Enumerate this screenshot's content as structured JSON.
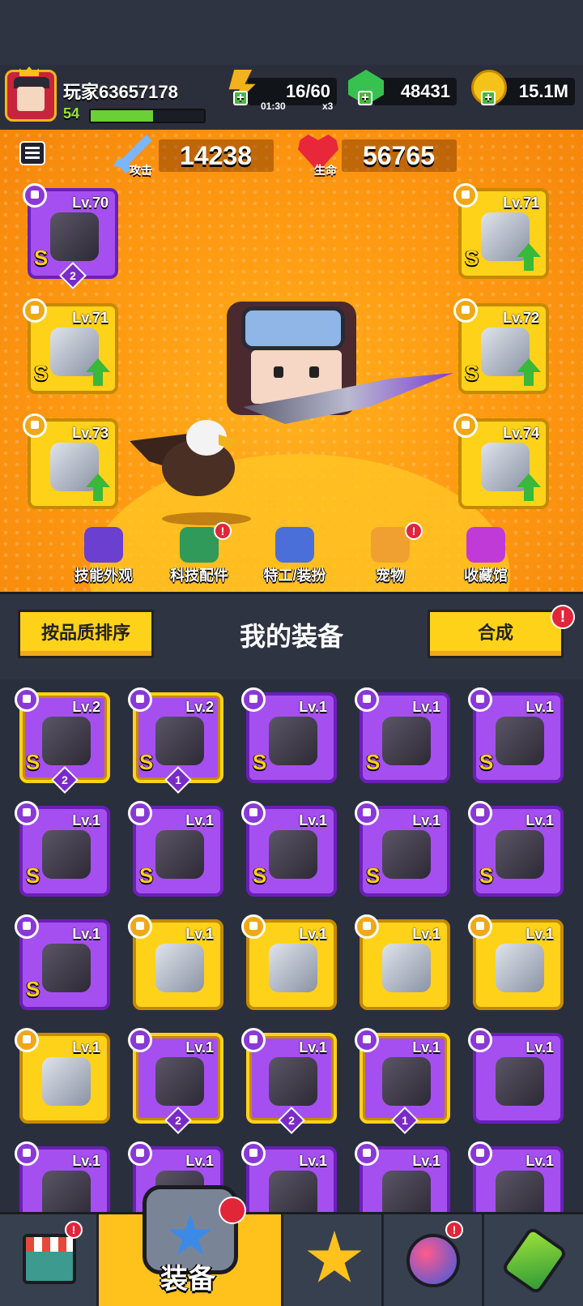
{
  "player": {
    "name": "玩家63657178",
    "level": "54",
    "xp_fraction": 0.55
  },
  "resources": {
    "energy": {
      "value": "16/60",
      "timer": "01:30",
      "multiplier": "x3",
      "icon": "energy-icon"
    },
    "gems": {
      "value": "48431",
      "icon": "gem-icon"
    },
    "coins": {
      "value": "15.1M",
      "icon": "coin-icon"
    }
  },
  "stats": {
    "attack": {
      "label": "攻击",
      "value": "14238"
    },
    "health": {
      "label": "生命",
      "value": "56765"
    }
  },
  "equipped": {
    "left": [
      {
        "level": "Lv.70",
        "grade": "S",
        "stars": "2",
        "color": "purple",
        "upgrade": false
      },
      {
        "level": "Lv.71",
        "grade": "S",
        "stars": "",
        "color": "gold",
        "upgrade": true
      },
      {
        "level": "Lv.73",
        "grade": "",
        "stars": "",
        "color": "gold",
        "upgrade": true
      }
    ],
    "right": [
      {
        "level": "Lv.71",
        "grade": "S",
        "stars": "",
        "color": "gold",
        "upgrade": true
      },
      {
        "level": "Lv.72",
        "grade": "S",
        "stars": "",
        "color": "gold",
        "upgrade": true
      },
      {
        "level": "Lv.74",
        "grade": "",
        "stars": "",
        "color": "gold",
        "upgrade": true
      }
    ]
  },
  "feature_bar": [
    {
      "label": "技能外观",
      "icon": "skill-skin-icon",
      "badge": false
    },
    {
      "label": "科技配件",
      "icon": "tech-parts-icon",
      "badge": true
    },
    {
      "label": "特工/装扮",
      "icon": "agent-costume-icon",
      "badge": false
    },
    {
      "label": "宠物",
      "icon": "pet-icon",
      "badge": true
    },
    {
      "label": "收藏馆",
      "icon": "collection-icon",
      "badge": false
    }
  ],
  "equipment_bar": {
    "sort_label": "按品质排序",
    "title": "我的装备",
    "merge_label": "合成"
  },
  "inventory": [
    {
      "level": "Lv.2",
      "grade": "S",
      "stars": "2",
      "color": "purple",
      "gold_frame": true
    },
    {
      "level": "Lv.2",
      "grade": "S",
      "stars": "1",
      "color": "purple",
      "gold_frame": true
    },
    {
      "level": "Lv.1",
      "grade": "S",
      "stars": "",
      "color": "purple",
      "gold_frame": false
    },
    {
      "level": "Lv.1",
      "grade": "S",
      "stars": "",
      "color": "purple",
      "gold_frame": false
    },
    {
      "level": "Lv.1",
      "grade": "S",
      "stars": "",
      "color": "purple",
      "gold_frame": false
    },
    {
      "level": "Lv.1",
      "grade": "S",
      "stars": "",
      "color": "purple",
      "gold_frame": false
    },
    {
      "level": "Lv.1",
      "grade": "S",
      "stars": "",
      "color": "purple",
      "gold_frame": false
    },
    {
      "level": "Lv.1",
      "grade": "S",
      "stars": "",
      "color": "purple",
      "gold_frame": false
    },
    {
      "level": "Lv.1",
      "grade": "S",
      "stars": "",
      "color": "purple",
      "gold_frame": false
    },
    {
      "level": "Lv.1",
      "grade": "S",
      "stars": "",
      "color": "purple",
      "gold_frame": false
    },
    {
      "level": "Lv.1",
      "grade": "S",
      "stars": "",
      "color": "purple",
      "gold_frame": false
    },
    {
      "level": "Lv.1",
      "grade": "",
      "stars": "",
      "color": "gold",
      "gold_frame": false
    },
    {
      "level": "Lv.1",
      "grade": "",
      "stars": "",
      "color": "gold",
      "gold_frame": false
    },
    {
      "level": "Lv.1",
      "grade": "",
      "stars": "",
      "color": "gold",
      "gold_frame": false
    },
    {
      "level": "Lv.1",
      "grade": "",
      "stars": "",
      "color": "gold",
      "gold_frame": false
    },
    {
      "level": "Lv.1",
      "grade": "",
      "stars": "",
      "color": "gold",
      "gold_frame": false
    },
    {
      "level": "Lv.1",
      "grade": "",
      "stars": "2",
      "color": "purple",
      "gold_frame": true
    },
    {
      "level": "Lv.1",
      "grade": "",
      "stars": "2",
      "color": "purple",
      "gold_frame": true
    },
    {
      "level": "Lv.1",
      "grade": "",
      "stars": "1",
      "color": "purple",
      "gold_frame": true
    },
    {
      "level": "Lv.1",
      "grade": "",
      "stars": "",
      "color": "purple",
      "gold_frame": false
    },
    {
      "level": "Lv.1",
      "grade": "",
      "stars": "",
      "color": "purple",
      "gold_frame": false
    },
    {
      "level": "Lv.1",
      "grade": "",
      "stars": "",
      "color": "purple",
      "gold_frame": false
    },
    {
      "level": "Lv.1",
      "grade": "",
      "stars": "",
      "color": "purple",
      "gold_frame": false
    },
    {
      "level": "Lv.1",
      "grade": "",
      "stars": "",
      "color": "purple",
      "gold_frame": false
    },
    {
      "level": "Lv.1",
      "grade": "",
      "stars": "",
      "color": "purple",
      "gold_frame": false
    }
  ],
  "bottom_nav": [
    {
      "label": "",
      "icon": "shop-icon",
      "badge": true,
      "active": false
    },
    {
      "label": "装备",
      "icon": "equipment-icon",
      "badge": true,
      "active": true
    },
    {
      "label": "",
      "icon": "battle-icon",
      "badge": false,
      "active": false
    },
    {
      "label": "",
      "icon": "planet-icon",
      "badge": true,
      "active": false
    },
    {
      "label": "",
      "icon": "lab-icon",
      "badge": false,
      "active": false
    }
  ],
  "colors": {
    "purple": "#a64ff0",
    "gold": "#ffd21a",
    "orange_bg": "#ff9b12",
    "dark_bg": "#2c3140"
  }
}
